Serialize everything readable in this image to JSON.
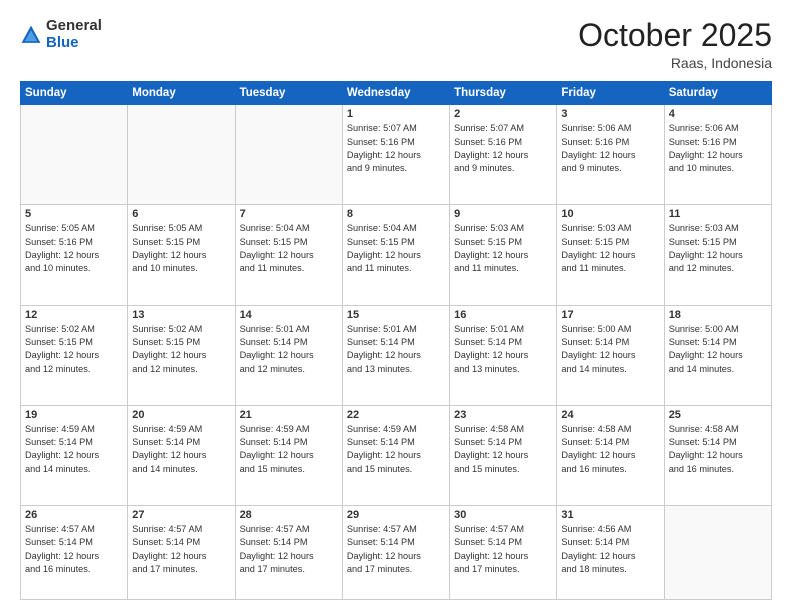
{
  "header": {
    "logo": {
      "general": "General",
      "blue": "Blue"
    },
    "title": "October 2025",
    "location": "Raas, Indonesia"
  },
  "days_of_week": [
    "Sunday",
    "Monday",
    "Tuesday",
    "Wednesday",
    "Thursday",
    "Friday",
    "Saturday"
  ],
  "weeks": [
    [
      {
        "day": "",
        "info": ""
      },
      {
        "day": "",
        "info": ""
      },
      {
        "day": "",
        "info": ""
      },
      {
        "day": "1",
        "info": "Sunrise: 5:07 AM\nSunset: 5:16 PM\nDaylight: 12 hours\nand 9 minutes."
      },
      {
        "day": "2",
        "info": "Sunrise: 5:07 AM\nSunset: 5:16 PM\nDaylight: 12 hours\nand 9 minutes."
      },
      {
        "day": "3",
        "info": "Sunrise: 5:06 AM\nSunset: 5:16 PM\nDaylight: 12 hours\nand 9 minutes."
      },
      {
        "day": "4",
        "info": "Sunrise: 5:06 AM\nSunset: 5:16 PM\nDaylight: 12 hours\nand 10 minutes."
      }
    ],
    [
      {
        "day": "5",
        "info": "Sunrise: 5:05 AM\nSunset: 5:16 PM\nDaylight: 12 hours\nand 10 minutes."
      },
      {
        "day": "6",
        "info": "Sunrise: 5:05 AM\nSunset: 5:15 PM\nDaylight: 12 hours\nand 10 minutes."
      },
      {
        "day": "7",
        "info": "Sunrise: 5:04 AM\nSunset: 5:15 PM\nDaylight: 12 hours\nand 11 minutes."
      },
      {
        "day": "8",
        "info": "Sunrise: 5:04 AM\nSunset: 5:15 PM\nDaylight: 12 hours\nand 11 minutes."
      },
      {
        "day": "9",
        "info": "Sunrise: 5:03 AM\nSunset: 5:15 PM\nDaylight: 12 hours\nand 11 minutes."
      },
      {
        "day": "10",
        "info": "Sunrise: 5:03 AM\nSunset: 5:15 PM\nDaylight: 12 hours\nand 11 minutes."
      },
      {
        "day": "11",
        "info": "Sunrise: 5:03 AM\nSunset: 5:15 PM\nDaylight: 12 hours\nand 12 minutes."
      }
    ],
    [
      {
        "day": "12",
        "info": "Sunrise: 5:02 AM\nSunset: 5:15 PM\nDaylight: 12 hours\nand 12 minutes."
      },
      {
        "day": "13",
        "info": "Sunrise: 5:02 AM\nSunset: 5:15 PM\nDaylight: 12 hours\nand 12 minutes."
      },
      {
        "day": "14",
        "info": "Sunrise: 5:01 AM\nSunset: 5:14 PM\nDaylight: 12 hours\nand 12 minutes."
      },
      {
        "day": "15",
        "info": "Sunrise: 5:01 AM\nSunset: 5:14 PM\nDaylight: 12 hours\nand 13 minutes."
      },
      {
        "day": "16",
        "info": "Sunrise: 5:01 AM\nSunset: 5:14 PM\nDaylight: 12 hours\nand 13 minutes."
      },
      {
        "day": "17",
        "info": "Sunrise: 5:00 AM\nSunset: 5:14 PM\nDaylight: 12 hours\nand 14 minutes."
      },
      {
        "day": "18",
        "info": "Sunrise: 5:00 AM\nSunset: 5:14 PM\nDaylight: 12 hours\nand 14 minutes."
      }
    ],
    [
      {
        "day": "19",
        "info": "Sunrise: 4:59 AM\nSunset: 5:14 PM\nDaylight: 12 hours\nand 14 minutes."
      },
      {
        "day": "20",
        "info": "Sunrise: 4:59 AM\nSunset: 5:14 PM\nDaylight: 12 hours\nand 14 minutes."
      },
      {
        "day": "21",
        "info": "Sunrise: 4:59 AM\nSunset: 5:14 PM\nDaylight: 12 hours\nand 15 minutes."
      },
      {
        "day": "22",
        "info": "Sunrise: 4:59 AM\nSunset: 5:14 PM\nDaylight: 12 hours\nand 15 minutes."
      },
      {
        "day": "23",
        "info": "Sunrise: 4:58 AM\nSunset: 5:14 PM\nDaylight: 12 hours\nand 15 minutes."
      },
      {
        "day": "24",
        "info": "Sunrise: 4:58 AM\nSunset: 5:14 PM\nDaylight: 12 hours\nand 16 minutes."
      },
      {
        "day": "25",
        "info": "Sunrise: 4:58 AM\nSunset: 5:14 PM\nDaylight: 12 hours\nand 16 minutes."
      }
    ],
    [
      {
        "day": "26",
        "info": "Sunrise: 4:57 AM\nSunset: 5:14 PM\nDaylight: 12 hours\nand 16 minutes."
      },
      {
        "day": "27",
        "info": "Sunrise: 4:57 AM\nSunset: 5:14 PM\nDaylight: 12 hours\nand 17 minutes."
      },
      {
        "day": "28",
        "info": "Sunrise: 4:57 AM\nSunset: 5:14 PM\nDaylight: 12 hours\nand 17 minutes."
      },
      {
        "day": "29",
        "info": "Sunrise: 4:57 AM\nSunset: 5:14 PM\nDaylight: 12 hours\nand 17 minutes."
      },
      {
        "day": "30",
        "info": "Sunrise: 4:57 AM\nSunset: 5:14 PM\nDaylight: 12 hours\nand 17 minutes."
      },
      {
        "day": "31",
        "info": "Sunrise: 4:56 AM\nSunset: 5:14 PM\nDaylight: 12 hours\nand 18 minutes."
      },
      {
        "day": "",
        "info": ""
      }
    ]
  ]
}
